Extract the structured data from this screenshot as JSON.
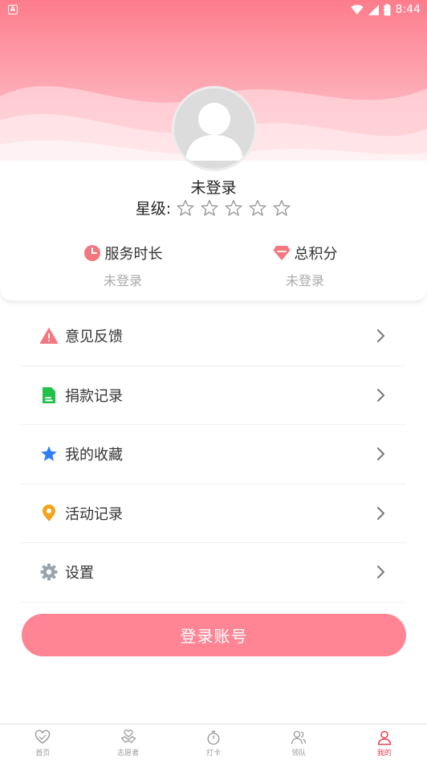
{
  "status_bar": {
    "time": "8:44",
    "left_icon": "a-box-icon",
    "icons": [
      "wifi-icon",
      "signal-icon",
      "battery-icon"
    ]
  },
  "profile": {
    "username": "未登录",
    "star_label": "星级:",
    "stars_filled": 0,
    "stars_total": 5
  },
  "stats": [
    {
      "label": "服务时长",
      "value": "未登录",
      "icon": "clock-icon",
      "color": "#f2777f"
    },
    {
      "label": "总积分",
      "value": "未登录",
      "icon": "diamond-icon",
      "color": "#f2777f"
    }
  ],
  "menu": [
    {
      "label": "意见反馈",
      "icon": "warning-icon",
      "color": "#f2777f"
    },
    {
      "label": "捐款记录",
      "icon": "document-icon",
      "color": "#22c24a"
    },
    {
      "label": "我的收藏",
      "icon": "star-icon",
      "color": "#2f7ef4"
    },
    {
      "label": "活动记录",
      "icon": "location-pin-icon",
      "color": "#f5a31a"
    },
    {
      "label": "设置",
      "icon": "gear-icon",
      "color": "#9aa3ad"
    }
  ],
  "login_button": "登录账号",
  "tabs": [
    {
      "label": "首页",
      "icon": "heart-outline-icon",
      "active": false
    },
    {
      "label": "志愿者",
      "icon": "handshake-heart-icon",
      "active": false
    },
    {
      "label": "打卡",
      "icon": "stopwatch-icon",
      "active": false
    },
    {
      "label": "领队",
      "icon": "team-icon",
      "active": false
    },
    {
      "label": "我的",
      "icon": "person-icon",
      "active": true
    }
  ],
  "colors": {
    "accent": "#ff8595",
    "header_gradient_top": "#fd7c8b",
    "active_tab": "#e8424f"
  }
}
